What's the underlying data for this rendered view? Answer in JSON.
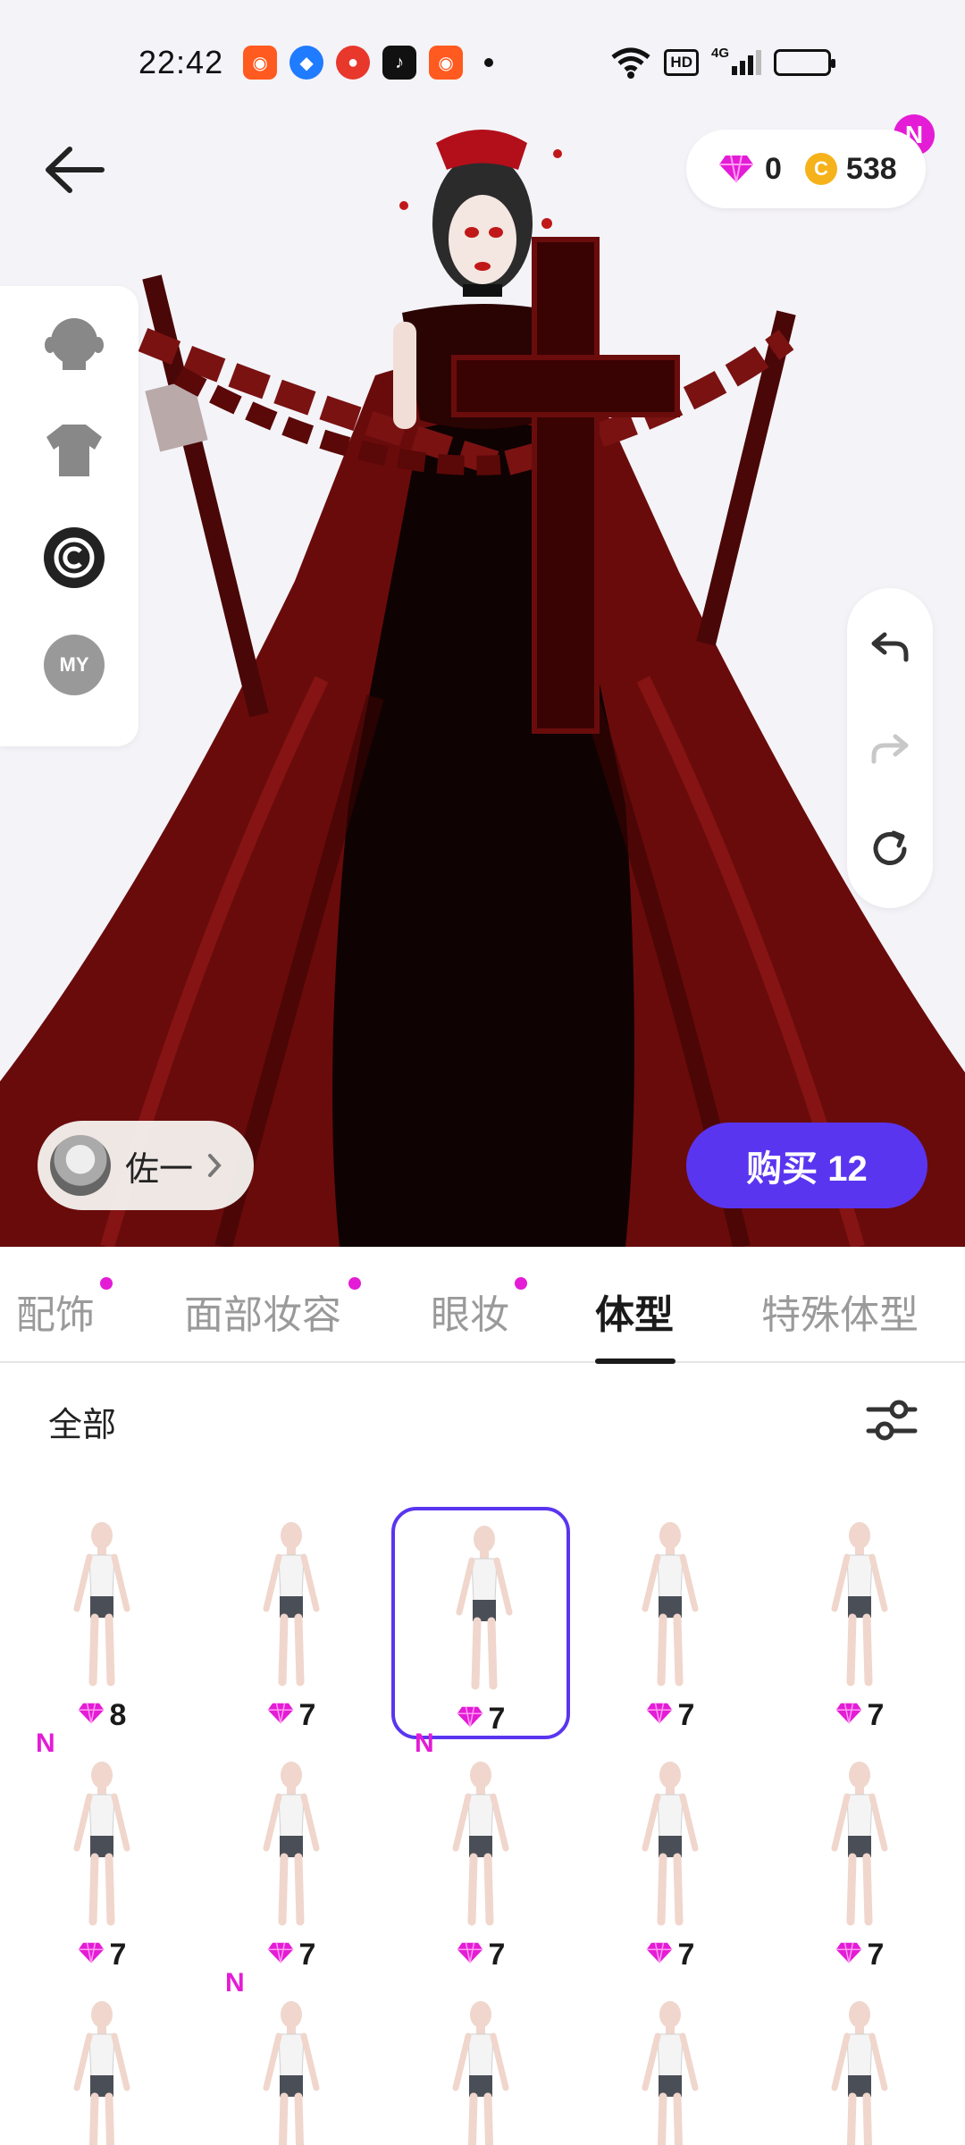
{
  "status_bar": {
    "time": "22:42",
    "network": "4G",
    "hd": "HD",
    "apps": [
      {
        "icon": "kuaishou-icon",
        "color": "#ff5a1f"
      },
      {
        "icon": "blue-app-icon",
        "color": "#1f7bff"
      },
      {
        "icon": "red-app-icon",
        "color": "#e8372b"
      },
      {
        "icon": "tiktok-icon",
        "color": "#111111"
      },
      {
        "icon": "kuaishou-icon",
        "color": "#ff5a1f"
      }
    ]
  },
  "header": {
    "back_icon": "arrow-left-icon",
    "gems": "0",
    "coins": "538",
    "coin_symbol": "C",
    "new_badge": "N"
  },
  "side_menu": [
    "head-icon",
    "shirt-icon",
    "copyright-icon",
    "my-icon"
  ],
  "side_menu_my_label": "MY",
  "history": [
    "undo-icon",
    "redo-icon",
    "reset-icon"
  ],
  "friend": {
    "name": "佐一"
  },
  "buy_button": "购买 12",
  "tabs": [
    {
      "label": "配饰",
      "dot": true
    },
    {
      "label": "面部妆容",
      "dot": true
    },
    {
      "label": "眼妆",
      "dot": true
    },
    {
      "label": "体型",
      "dot": false,
      "active": true
    },
    {
      "label": "特殊体型",
      "dot": false
    }
  ],
  "filter": {
    "label": "全部",
    "icon": "sliders-icon"
  },
  "grid_items": [
    {
      "price": "8",
      "new": false,
      "selected": false
    },
    {
      "price": "7",
      "new": false,
      "selected": false
    },
    {
      "price": "7",
      "new": false,
      "selected": true
    },
    {
      "price": "7",
      "new": false,
      "selected": false
    },
    {
      "price": "7",
      "new": false,
      "selected": false
    },
    {
      "price": "7",
      "new": true,
      "selected": false
    },
    {
      "price": "7",
      "new": false,
      "selected": false
    },
    {
      "price": "7",
      "new": true,
      "selected": false
    },
    {
      "price": "7",
      "new": false,
      "selected": false
    },
    {
      "price": "7",
      "new": false,
      "selected": false
    },
    {
      "price": "",
      "new": false,
      "selected": false
    },
    {
      "price": "",
      "new": true,
      "selected": false
    },
    {
      "price": "",
      "new": false,
      "selected": false
    },
    {
      "price": "",
      "new": false,
      "selected": false
    },
    {
      "price": "",
      "new": false,
      "selected": false
    }
  ],
  "new_mark": "N",
  "colors": {
    "accent": "#5a35f0",
    "gem": "#e41cd6",
    "coin": "#f6b21a"
  }
}
